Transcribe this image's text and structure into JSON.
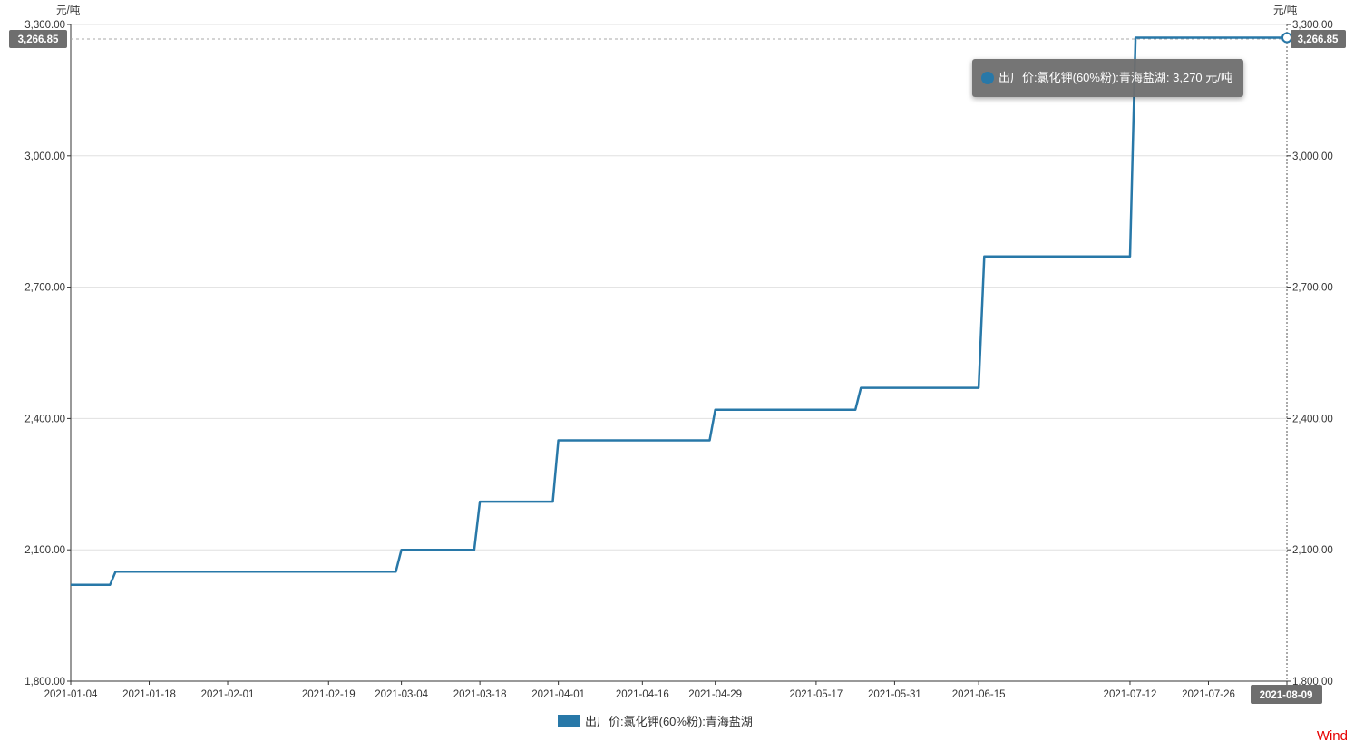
{
  "chart_data": {
    "type": "line",
    "step": true,
    "y_unit_left": "元/吨",
    "y_unit_right": "元/吨",
    "ylim": [
      1800,
      3300
    ],
    "y_ticks": [
      "3,300.00",
      "3,000.00",
      "2,700.00",
      "2,400.00",
      "2,100.00",
      "1,800.00"
    ],
    "y_tick_values": [
      3300,
      3000,
      2700,
      2400,
      2100,
      1800
    ],
    "x_ticks": [
      "2021-01-04",
      "2021-01-18",
      "2021-02-01",
      "2021-02-19",
      "2021-03-04",
      "2021-03-18",
      "2021-04-01",
      "2021-04-16",
      "2021-04-29",
      "2021-05-17",
      "2021-05-31",
      "2021-06-15",
      "2021-07-12",
      "2021-07-26",
      "2021-08-09"
    ],
    "grid": true,
    "series": [
      {
        "name": "出厂价:氯化钾(60%粉):青海盐湖",
        "color": "#2878a8",
        "points": [
          {
            "x": "2021-01-04",
            "y": 2020
          },
          {
            "x": "2021-01-11",
            "y": 2020
          },
          {
            "x": "2021-01-12",
            "y": 2050
          },
          {
            "x": "2021-03-03",
            "y": 2050
          },
          {
            "x": "2021-03-04",
            "y": 2100
          },
          {
            "x": "2021-03-17",
            "y": 2100
          },
          {
            "x": "2021-03-18",
            "y": 2210
          },
          {
            "x": "2021-03-31",
            "y": 2210
          },
          {
            "x": "2021-04-01",
            "y": 2350
          },
          {
            "x": "2021-04-28",
            "y": 2350
          },
          {
            "x": "2021-04-29",
            "y": 2420
          },
          {
            "x": "2021-05-24",
            "y": 2420
          },
          {
            "x": "2021-05-25",
            "y": 2470
          },
          {
            "x": "2021-06-15",
            "y": 2470
          },
          {
            "x": "2021-06-16",
            "y": 2770
          },
          {
            "x": "2021-07-12",
            "y": 2770
          },
          {
            "x": "2021-07-13",
            "y": 3270
          },
          {
            "x": "2021-08-09",
            "y": 3270
          }
        ]
      }
    ],
    "crosshair": {
      "x_label": "2021-08-09",
      "y_label": "3,266.85"
    },
    "tooltip": {
      "label": "出厂价:氯化钾(60%粉):青海盐湖: 3,270 元/吨"
    },
    "legend": {
      "label": "出厂价:氯化钾(60%粉):青海盐湖",
      "position": "bottom-center"
    }
  },
  "brand": "Wind"
}
